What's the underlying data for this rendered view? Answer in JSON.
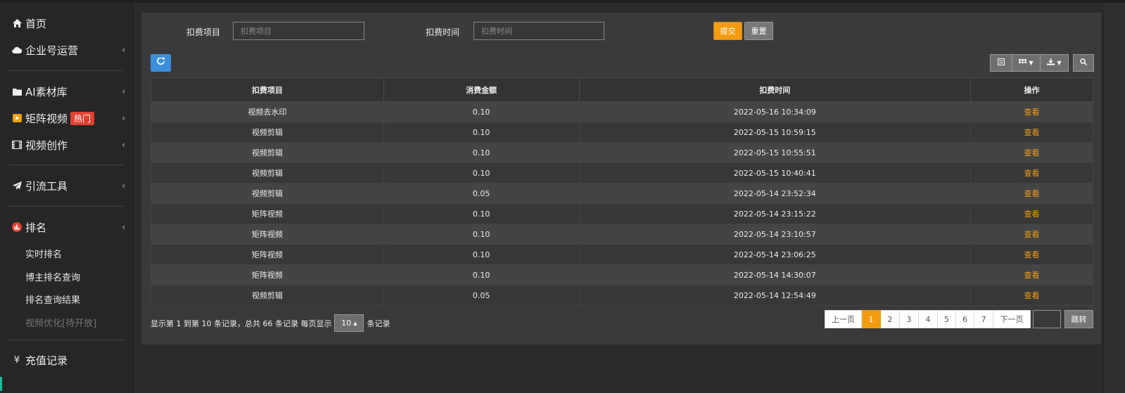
{
  "sidebar": {
    "home": "首页",
    "enterprise": "企业号运营",
    "ai_library": "AI素材库",
    "matrix_video": "矩阵视频",
    "hot_badge": "热门",
    "video_create": "视频创作",
    "traffic_tools": "引流工具",
    "ranking": "排名",
    "sub_items": [
      "实时排名",
      "博主排名查询",
      "排名查询结果",
      "视频优化[待开放]"
    ],
    "recharge": "充值记录",
    "currency_symbol": "¥"
  },
  "filter": {
    "item_label": "扣费项目",
    "item_placeholder": "扣费项目",
    "time_label": "扣费时间",
    "time_placeholder": "扣费时间",
    "submit": "提交",
    "reset": "重置"
  },
  "table": {
    "headers": [
      "扣费项目",
      "消费金额",
      "扣费时间",
      "操作"
    ],
    "rows": [
      {
        "item": "视频去水印",
        "amount": "0.10",
        "time": "2022-05-16 10:34:09",
        "op": "查看"
      },
      {
        "item": "视频剪辑",
        "amount": "0.10",
        "time": "2022-05-15 10:59:15",
        "op": "查看"
      },
      {
        "item": "视频剪辑",
        "amount": "0.10",
        "time": "2022-05-15 10:55:51",
        "op": "查看"
      },
      {
        "item": "视频剪辑",
        "amount": "0.10",
        "time": "2022-05-15 10:40:41",
        "op": "查看"
      },
      {
        "item": "视频剪辑",
        "amount": "0.05",
        "time": "2022-05-14 23:52:34",
        "op": "查看"
      },
      {
        "item": "矩阵视频",
        "amount": "0.10",
        "time": "2022-05-14 23:15:22",
        "op": "查看"
      },
      {
        "item": "矩阵视频",
        "amount": "0.10",
        "time": "2022-05-14 23:10:57",
        "op": "查看"
      },
      {
        "item": "矩阵视频",
        "amount": "0.10",
        "time": "2022-05-14 23:06:25",
        "op": "查看"
      },
      {
        "item": "矩阵视频",
        "amount": "0.10",
        "time": "2022-05-14 14:30:07",
        "op": "查看"
      },
      {
        "item": "视频剪辑",
        "amount": "0.05",
        "time": "2022-05-14 12:54:49",
        "op": "查看"
      }
    ]
  },
  "pagination": {
    "info_prefix": "显示第 1 到第 10 条记录，总共 66 条记录 每页显示",
    "page_size": "10",
    "info_suffix": "条记录",
    "prev": "上一页",
    "pages": [
      "1",
      "2",
      "3",
      "4",
      "5",
      "6",
      "7"
    ],
    "next": "下一页",
    "jump": "跳转"
  },
  "colors": {
    "accent": "#f39c12",
    "primary": "#3c8dda",
    "hot": "#e0422f"
  }
}
